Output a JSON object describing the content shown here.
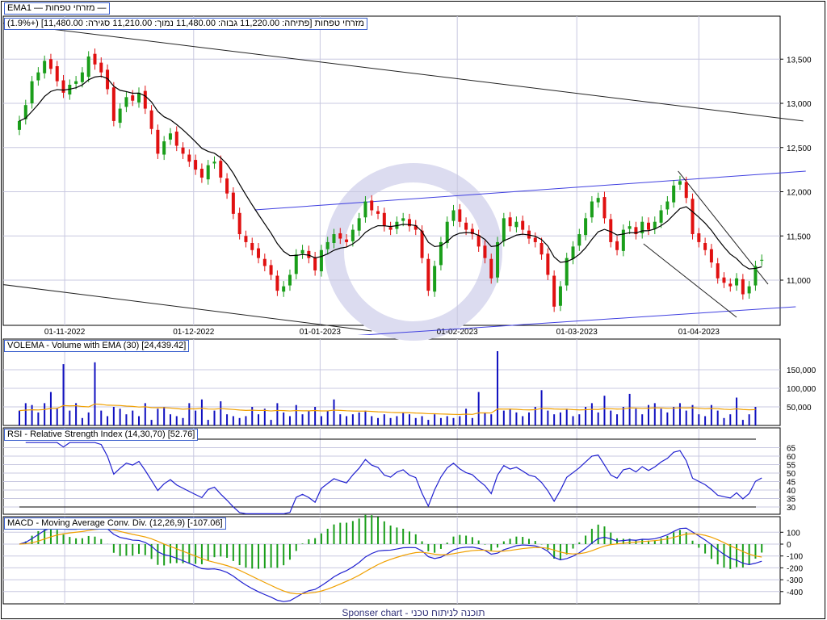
{
  "legend": {
    "series_name": "מזרחי טפחות",
    "ema_name": "EMA1"
  },
  "info_bar": "מזרחי טפחות [פתיחה: 11,220.00 גבוה: 11,480.00 נמוך: 11,210.00 סגירה: 11,480.00] (+1.9%)",
  "panels": {
    "volume": "VOLEMA - Volume with EMA (30) [24,439.42]",
    "rsi": "RSI - Relative Strength Index (14,30,70) [52.76]",
    "macd": "MACD - Moving Average Conv. Div. (12,26,9) [-107.06]"
  },
  "footer": "Sponser chart - תוכנה לניתוח טכני",
  "colors": {
    "up": "#1a9e1a",
    "down": "#e01010",
    "ema": "#000000",
    "volume": "#1010c0",
    "vol_ema": "#f0a000",
    "rsi": "#2020d0",
    "macd": "#2020d0",
    "signal": "#f0a000",
    "hist": "#1a9e1a",
    "channel": "#4040e0",
    "grid": "#c8c8e0"
  },
  "chart_data": {
    "type": "candlestick",
    "x_labels": [
      {
        "i": 7.2,
        "text": "01-11-2022"
      },
      {
        "i": 27.7,
        "text": "01-12-2022"
      },
      {
        "i": 47.8,
        "text": "01-01-2023"
      },
      {
        "i": 69.6,
        "text": "01-02-2023"
      },
      {
        "i": 88.6,
        "text": "01-03-2023"
      },
      {
        "i": 108,
        "text": "01-04-2023"
      }
    ],
    "price_ticks": [
      "13,500",
      "13,000",
      "12,500",
      "12,000",
      "11,500",
      "11,000"
    ],
    "price_tick_values": [
      13500,
      13000,
      12500,
      12000,
      11500,
      11000
    ],
    "ylim": [
      10450,
      14100
    ],
    "wick_pad": 60,
    "close": [
      12800,
      12980,
      13250,
      13350,
      13480,
      13390,
      13250,
      13120,
      13210,
      13250,
      13350,
      13530,
      13440,
      13350,
      13160,
      12800,
      12940,
      13070,
      13030,
      13120,
      12940,
      12710,
      12430,
      12570,
      12660,
      12520,
      12430,
      12340,
      12250,
      12160,
      12300,
      12340,
      12160,
      11980,
      11750,
      11520,
      11430,
      11340,
      11250,
      11160,
      11060,
      10880,
      10930,
      11060,
      11290,
      11340,
      11250,
      11110,
      11340,
      11430,
      11520,
      11470,
      11430,
      11570,
      11700,
      11890,
      11790,
      11750,
      11610,
      11570,
      11660,
      11700,
      11610,
      11570,
      11250,
      10880,
      11160,
      11430,
      11660,
      11790,
      11660,
      11570,
      11520,
      11380,
      11250,
      11020,
      11430,
      11700,
      11610,
      11660,
      11570,
      11470,
      11430,
      11290,
      11060,
      10700,
      10930,
      11250,
      11380,
      11520,
      11700,
      11890,
      11930,
      11700,
      11430,
      11340,
      11570,
      11610,
      11520,
      11660,
      11570,
      11660,
      11790,
      11890,
      12070,
      12120,
      11930,
      11520,
      11430,
      11340,
      11200,
      11020,
      10970,
      10930,
      11020,
      10840,
      10930,
      11160,
      11230,
      11480
    ],
    "open": [
      12700,
      12820,
      13000,
      13260,
      13340,
      13500,
      13420,
      13260,
      13100,
      13220,
      13240,
      13300,
      13560,
      13460,
      13380,
      13180,
      12780,
      12960,
      13090,
      13010,
      13140,
      12920,
      12700,
      12420,
      12590,
      12680,
      12500,
      12420,
      12360,
      12260,
      12140,
      12320,
      12350,
      12150,
      11990,
      11760,
      11500,
      11420,
      11360,
      11240,
      11170,
      11050,
      10870,
      10940,
      11070,
      11300,
      11330,
      11260,
      11100,
      11350,
      11420,
      11530,
      11460,
      11440,
      11560,
      11710,
      11900,
      11780,
      11760,
      11600,
      11580,
      11670,
      11690,
      11620,
      11560,
      11240,
      10870,
      11170,
      11420,
      11670,
      11800,
      11650,
      11580,
      11510,
      11390,
      11240,
      11030,
      11440,
      11710,
      11600,
      11670,
      11560,
      11480,
      11420,
      11300,
      11050,
      10710,
      10940,
      11240,
      11390,
      11510,
      11710,
      11880,
      11940,
      11690,
      11440,
      11330,
      11580,
      11600,
      11530,
      11650,
      11580,
      11650,
      11800,
      11880,
      12080,
      12110,
      11920,
      11530,
      11420,
      11350,
      11190,
      11030,
      10960,
      10940,
      11010,
      10850,
      10940,
      11220
    ],
    "volume_thousands": [
      40,
      60,
      55,
      35,
      60,
      90,
      45,
      165,
      40,
      60,
      20,
      35,
      170,
      40,
      25,
      50,
      45,
      30,
      40,
      25,
      60,
      15,
      45,
      50,
      30,
      25,
      20,
      60,
      40,
      70,
      15,
      40,
      65,
      30,
      25,
      20,
      25,
      50,
      30,
      45,
      15,
      60,
      35,
      25,
      55,
      30,
      40,
      50,
      25,
      40,
      70,
      30,
      25,
      30,
      35,
      40,
      25,
      20,
      30,
      20,
      25,
      35,
      30,
      20,
      25,
      15,
      30,
      20,
      25,
      20,
      25,
      45,
      20,
      90,
      35,
      30,
      200,
      40,
      45,
      35,
      25,
      35,
      50,
      95,
      40,
      30,
      35,
      45,
      25,
      30,
      50,
      60,
      35,
      80,
      40,
      30,
      50,
      85,
      45,
      30,
      55,
      60,
      45,
      35,
      50,
      60,
      40,
      55,
      30,
      25,
      55,
      40,
      20,
      30,
      75,
      15,
      30,
      50
    ],
    "ema_period": 10,
    "volume_ema_period": 30,
    "rsi_params": [
      14,
      30,
      70
    ],
    "macd_params": [
      12,
      26,
      9
    ],
    "volume_ticks": [
      "150,000",
      "100,000",
      "50,000"
    ],
    "volume_tick_values": [
      150,
      100,
      50
    ],
    "rsi_ticks": [
      "65",
      "60",
      "55",
      "50",
      "45",
      "40",
      "35",
      "30"
    ],
    "macd_ticks": [
      "100",
      "0",
      "-100",
      "-200",
      "-300",
      "-400"
    ],
    "trendlines": [
      {
        "kind": "black",
        "from": [
          -3,
          13910
        ],
        "to": [
          124.6,
          12800
        ]
      },
      {
        "kind": "black",
        "from": [
          -3.1,
          10954
        ],
        "to": [
          56,
          10425
        ]
      },
      {
        "kind": "blue",
        "from": [
          37.4,
          11794
        ],
        "to": [
          125,
          12233
        ]
      },
      {
        "kind": "blue",
        "from": [
          48.9,
          10352
        ],
        "to": [
          123.4,
          10699
        ]
      },
      {
        "kind": "black",
        "from": [
          104.7,
          12233
        ],
        "to": [
          119,
          10954
        ]
      },
      {
        "kind": "black",
        "from": [
          99.2,
          11411
        ],
        "to": [
          114,
          10580
        ]
      }
    ]
  }
}
